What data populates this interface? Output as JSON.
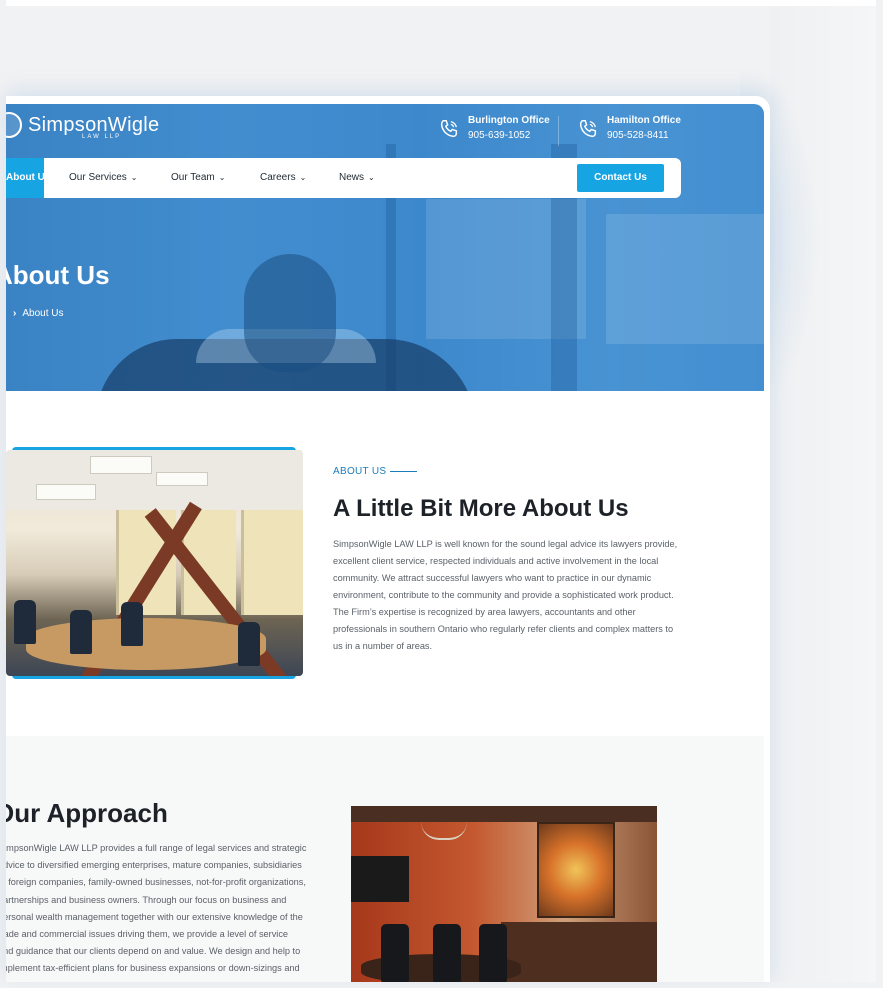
{
  "brand": {
    "name": "SimpsonWigle",
    "sub": "LAW LLP"
  },
  "offices": [
    {
      "name": "Burlington Office",
      "phone": "905-639-1052"
    },
    {
      "name": "Hamilton Office",
      "phone": "905-528-8411"
    }
  ],
  "nav": {
    "active": "About Us",
    "items": [
      {
        "label": "Our Services",
        "chevron": "⌄"
      },
      {
        "label": "Our Team",
        "chevron": "⌄"
      },
      {
        "label": "Careers",
        "chevron": "⌄"
      },
      {
        "label": "News",
        "chevron": "⌄"
      }
    ],
    "cta": "Contact Us"
  },
  "hero": {
    "title": "About Us",
    "breadcrumb": "About Us",
    "breadcrumb_sep": "›"
  },
  "about": {
    "kicker": "ABOUT US",
    "heading": "A Little Bit More About Us",
    "body": "SimpsonWigle LAW LLP is well known for the sound legal advice its lawyers provide, excellent client service, respected individuals and active involvement in the local community. We attract successful lawyers who want to practice in our dynamic environment, contribute to the community and provide a sophisticated work product. The Firm’s expertise is recognized by area lawyers, accountants and other professionals in southern Ontario who regularly refer clients and complex matters to us in a number of areas."
  },
  "approach": {
    "title": "Our Approach",
    "lines": [
      "SimpsonWigle LAW LLP provides a full range of legal services and strategic",
      "advice to diversified emerging enterprises, mature companies, subsidiaries",
      "of foreign companies, family-owned businesses, not-for-profit organizations,",
      "partnerships and business owners. Through our focus on business and",
      "personal wealth management together with our extensive knowledge of the",
      "trade and commercial issues driving them, we provide a level of service",
      "and guidance that our clients depend on and value. We design and help to",
      "implement tax-efficient plans for business expansions or down-sizings and"
    ]
  },
  "icons": {
    "phone": "phone-icon",
    "logo": "logo-icon",
    "chevron": "chevron-down-icon",
    "breadcrumb": "chevron-right-icon"
  },
  "colors": {
    "accent": "#17a4e3",
    "kicker": "#1b7dbb",
    "heading": "#1d2228",
    "body": "#5b6169",
    "hero_overlay": "#3a8cd2"
  }
}
